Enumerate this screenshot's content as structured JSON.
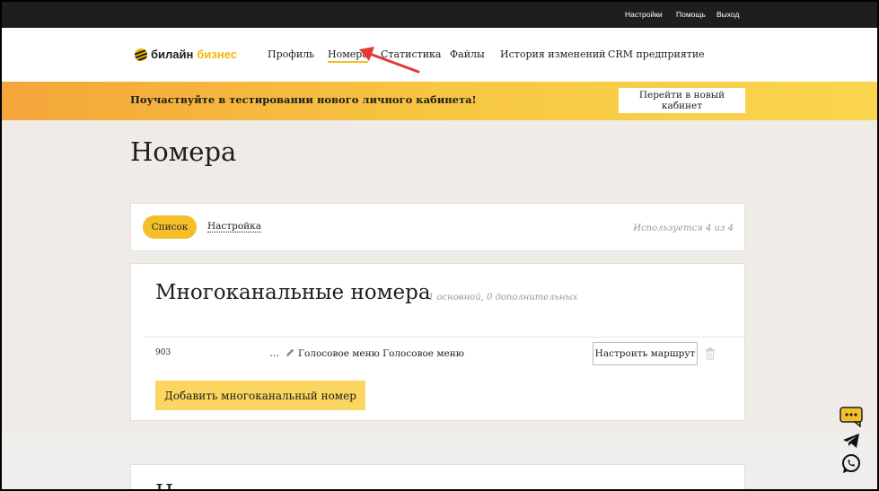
{
  "topbar": {
    "settings": "Настройки",
    "help": "Помощь",
    "logout": "Выход"
  },
  "logo": {
    "part1": "билайн",
    "part2": "бизнес"
  },
  "nav": {
    "profile": "Профиль",
    "numbers": "Номера",
    "stats": "Статистика",
    "files": "Файлы",
    "history": "История изменений",
    "crm": "CRM предприятие"
  },
  "banner": {
    "text": "Поучаствуйте в тестировании нового личного кабинета!",
    "button": "Перейти в новый кабинет"
  },
  "page": {
    "title": "Номера"
  },
  "tabs": {
    "list": "Список",
    "settings": "Настройка",
    "usage": "Используется 4 из 4"
  },
  "multichannel": {
    "title": "Многоканальные номера",
    "subtitle": "1 основной, 0 дополнительных",
    "row": {
      "number": "903",
      "dots": "…",
      "menu": "Голосовое меню Голосовое меню",
      "route_button": "Настроить маршрут"
    },
    "add_button": "Добавить многоканальный номер"
  },
  "next_card": {
    "title_partial": "Н"
  },
  "colors": {
    "accent": "#f5bf2b",
    "banner_start": "#f4a53a",
    "banner_end": "#fad54f",
    "topbar": "#1e1e1e",
    "arrow": "#e53935"
  },
  "icons": [
    "chat-bubble-icon",
    "telegram-icon",
    "whatsapp-icon",
    "pencil-icon",
    "trash-icon"
  ]
}
